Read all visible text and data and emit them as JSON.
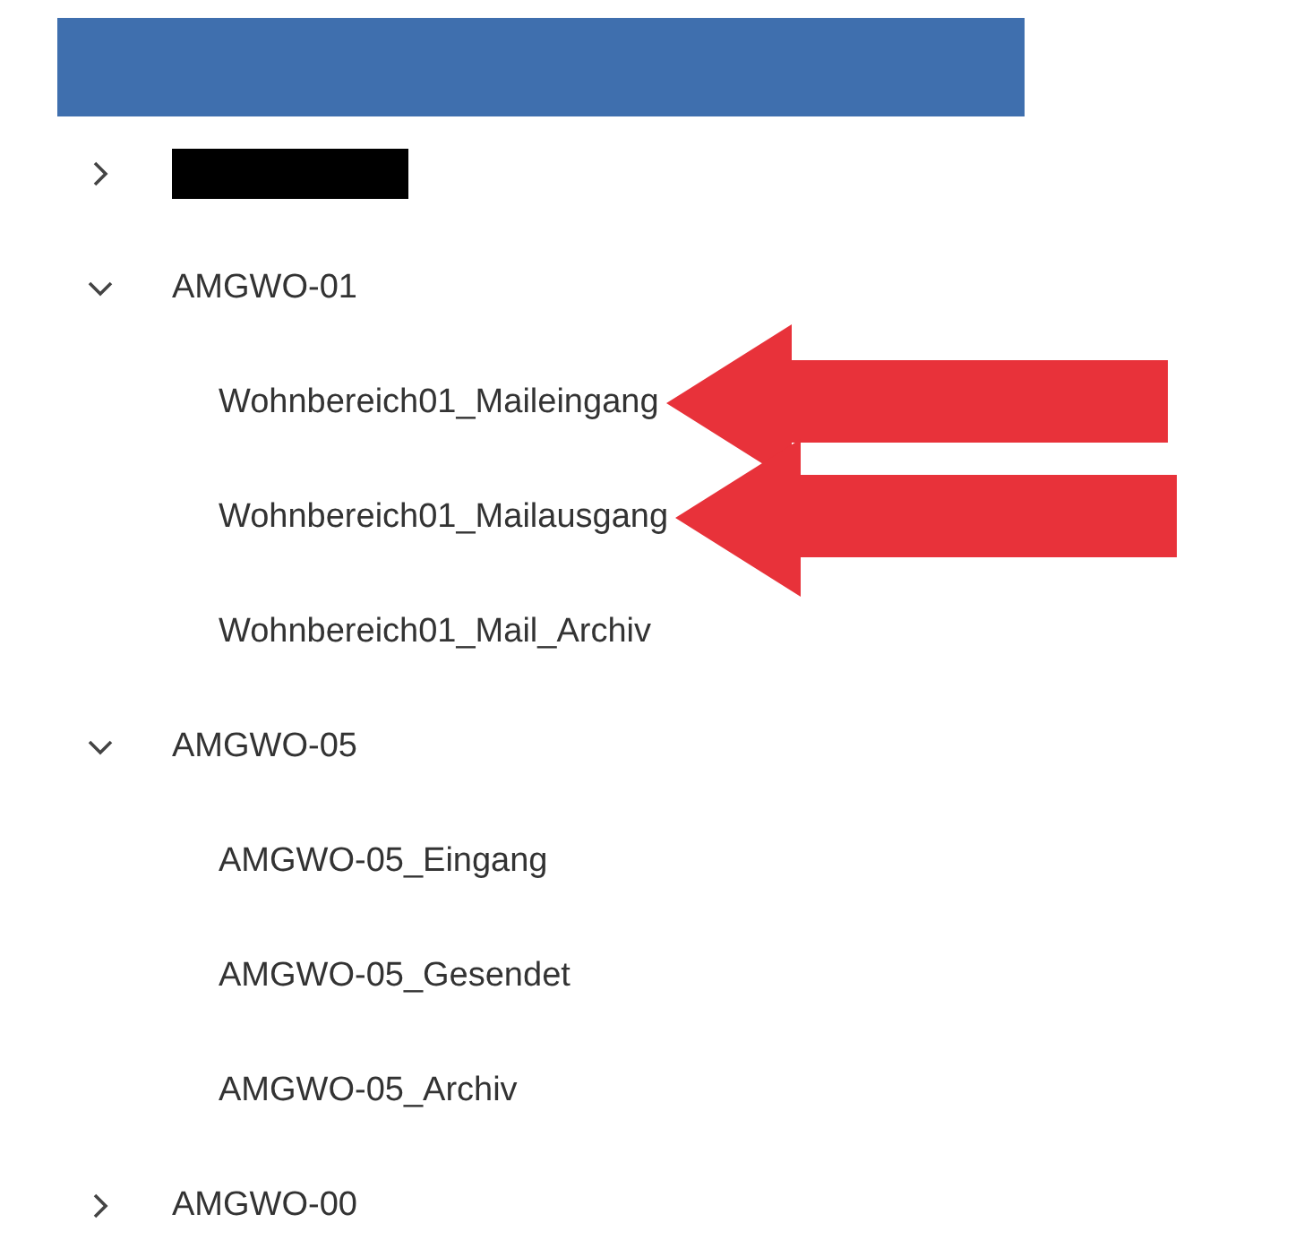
{
  "header": {
    "color": "#3f6fae"
  },
  "tree": [
    {
      "redacted": true,
      "expanded": false
    },
    {
      "label": "AMGWO-01",
      "expanded": true,
      "children": [
        {
          "label": "Wohnbereich01_Maileingang",
          "marked": true
        },
        {
          "label": "Wohnbereich01_Mailausgang",
          "marked": true
        },
        {
          "label": "Wohnbereich01_Mail_Archiv",
          "marked": false
        }
      ]
    },
    {
      "label": "AMGWO-05",
      "expanded": true,
      "children": [
        {
          "label": "AMGWO-05_Eingang",
          "marked": false
        },
        {
          "label": "AMGWO-05_Gesendet",
          "marked": false
        },
        {
          "label": "AMGWO-05_Archiv",
          "marked": false
        }
      ]
    },
    {
      "label": "AMGWO-00",
      "expanded": false
    }
  ]
}
